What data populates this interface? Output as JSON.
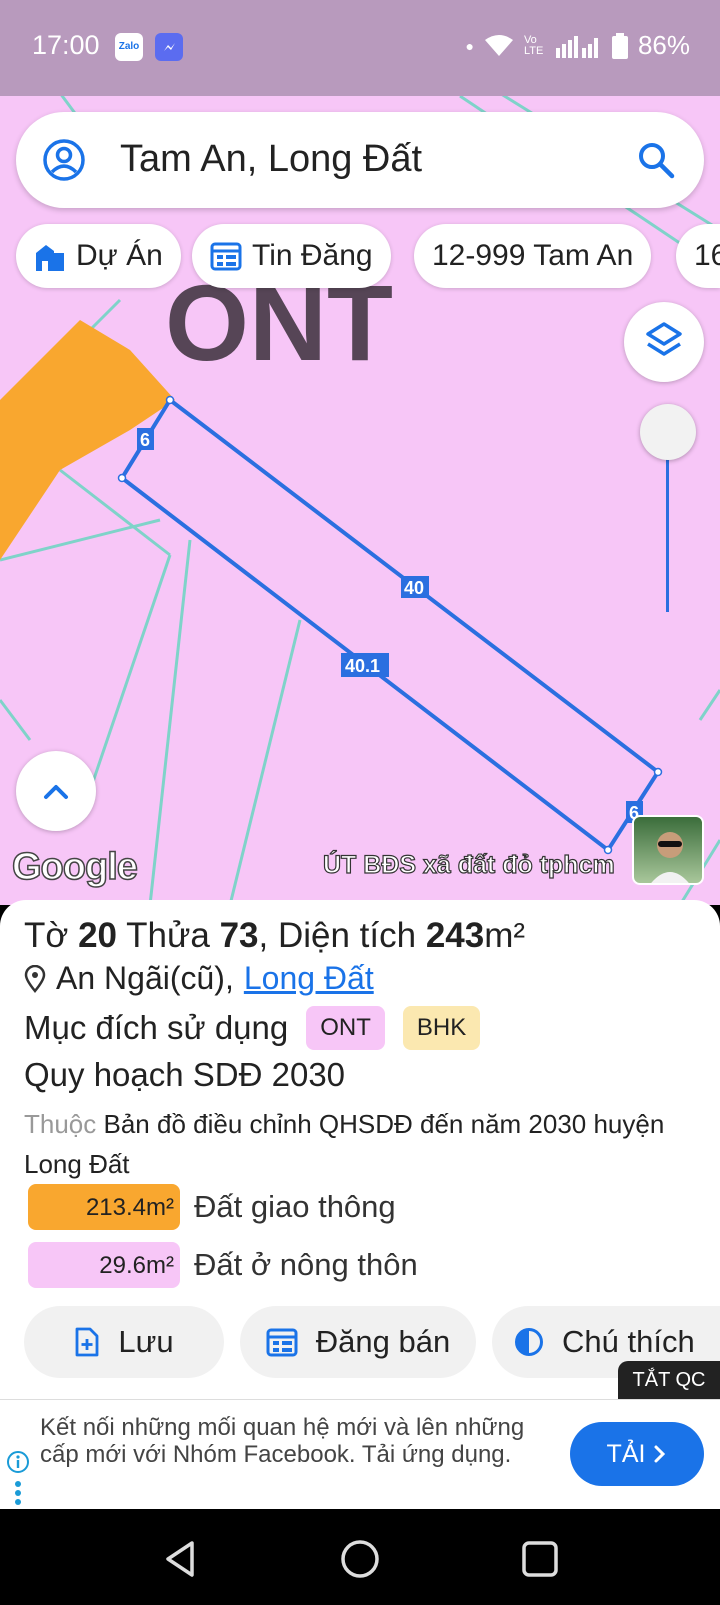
{
  "status_bar": {
    "time": "17:00",
    "app_icons": [
      "Zalo",
      "messenger-icon"
    ],
    "network": "Vo LTE",
    "battery": "86%"
  },
  "search": {
    "query": "Tam An, Long Đất"
  },
  "chips": [
    {
      "label": "Dự Án",
      "icon": "building-icon"
    },
    {
      "label": "Tin Đăng",
      "icon": "calendar-icon"
    },
    {
      "label": "12-999 Tam An"
    },
    {
      "label": "16"
    }
  ],
  "map": {
    "zone_label": "ONT",
    "edge_labels": {
      "top": "40",
      "bottom": "40.1",
      "left": "6",
      "right": "6"
    },
    "attribution": "Google",
    "watermark": "ÚT BĐS xã đất đỏ tphcm",
    "colors": {
      "land_pink": "#f7c6f7",
      "traffic_orange": "#f9a72f",
      "parcel_blue": "#2b6fe0"
    }
  },
  "parcel": {
    "title_prefix": "Tờ",
    "sheet_no": "20",
    "plot_label": "Thửa",
    "plot_no": "73",
    "area_label": ", Diện tích",
    "area_value": "243",
    "area_unit": "m²",
    "address_plain": "An Ngãi(cũ),",
    "address_link": "Long Đất",
    "purpose_label": "Mục đích sử dụng",
    "purpose_tags": [
      {
        "label": "ONT",
        "color": "#f7c6f7"
      },
      {
        "label": "BHK",
        "color": "#fbe8b0"
      }
    ],
    "plan_title": "Quy hoạch SDĐ 2030",
    "belong_prefix": "Thuộc",
    "belong_text": "Bản đồ điều chỉnh QHSDĐ đến năm 2030 huyện Long Đất",
    "areas": [
      {
        "value": "213.4m²",
        "label": "Đất giao thông",
        "color": "#f9a72f"
      },
      {
        "value": "29.6m²",
        "label": "Đất ở nông thôn",
        "color": "#f7c6f7"
      }
    ]
  },
  "actions": {
    "save": "Lưu",
    "post_sale": "Đăng bán",
    "legend": "Chú thích"
  },
  "ad": {
    "close_label": "TẮT QC",
    "text": "Kết nối những mối quan hệ mới và lên những cấp mới với Nhóm Facebook. Tải ứng dụng.",
    "cta": "TẢI"
  }
}
